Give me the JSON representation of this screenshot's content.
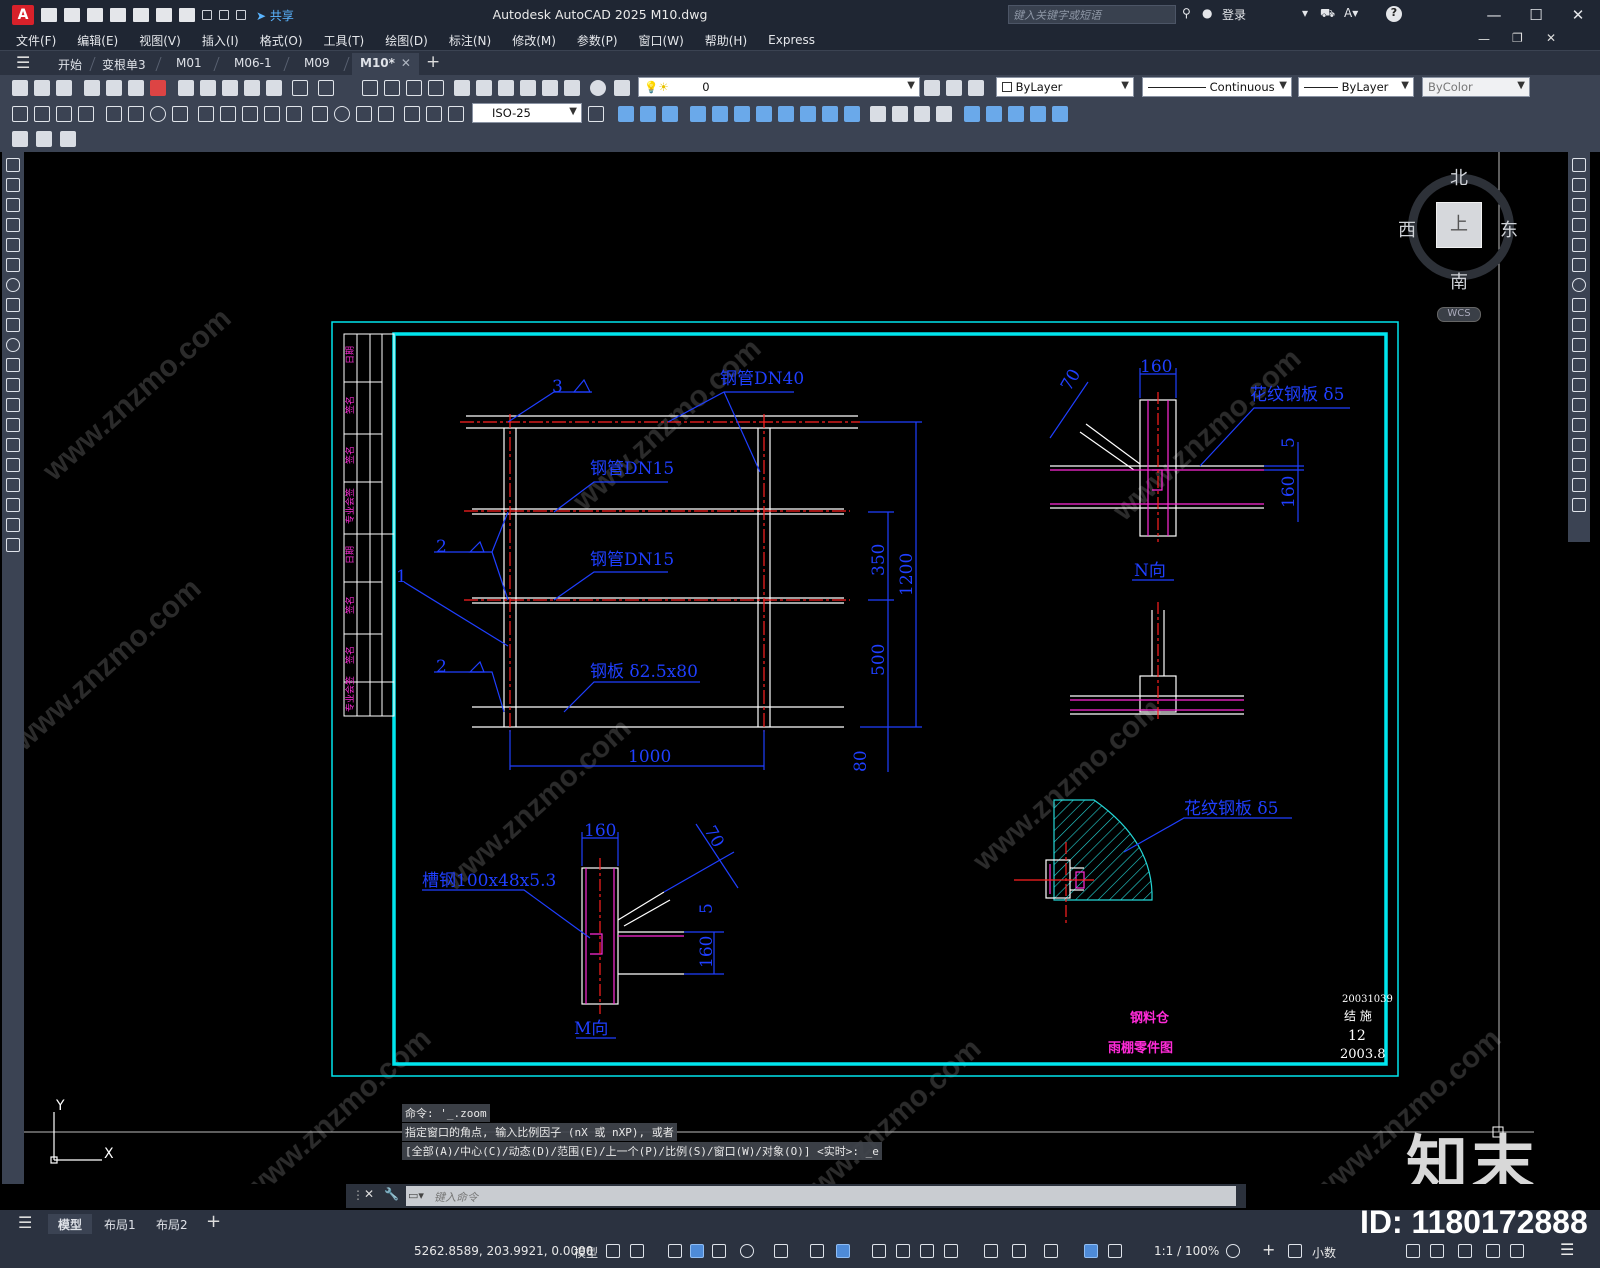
{
  "titlebar": {
    "logo": "A",
    "share_label": "共享",
    "title": "Autodesk AutoCAD 2025    M10.dwg",
    "search_placeholder": "键入关键字或短语",
    "login_label": "登录",
    "help_label": "?"
  },
  "menu": [
    "文件(F)",
    "编辑(E)",
    "视图(V)",
    "插入(I)",
    "格式(O)",
    "工具(T)",
    "绘图(D)",
    "标注(N)",
    "修改(M)",
    "参数(P)",
    "窗口(W)",
    "帮助(H)",
    "Express"
  ],
  "tabs": [
    {
      "label": "开始"
    },
    {
      "label": "变根单3"
    },
    {
      "label": "M01"
    },
    {
      "label": "M06-1"
    },
    {
      "label": "M09"
    },
    {
      "label": "M10*",
      "active": true
    }
  ],
  "toolbar": {
    "layer_value": "0",
    "color_value": "ByLayer",
    "linetype_value": "Continuous",
    "lineweight_value": "ByLayer",
    "plotstyle_value": "ByColor",
    "dimstyle_value": "ISO-25"
  },
  "viewcube": {
    "north": "北",
    "south": "南",
    "east": "东",
    "west": "西",
    "face": "上",
    "wcs": "WCS"
  },
  "drawing": {
    "labels": {
      "pipe_dn40": "钢管DN40",
      "pipe_dn15_a": "钢管DN15",
      "pipe_dn15_b": "钢管DN15",
      "plate": "钢板 δ2.5x80",
      "dim_1000": "1000",
      "dim_350": "350",
      "dim_1200": "1200",
      "dim_500": "500",
      "dim_80": "80",
      "weld_3": "3",
      "weld_2a": "2",
      "weld_2b": "2",
      "weld_1": "1",
      "n_dim_160": "160",
      "n_dim_70": "70",
      "n_checker": "花纹钢板 δ5",
      "n_dim_5": "5",
      "n_dim_160v": "160",
      "n_view": "N向",
      "m_dim_160": "160",
      "m_dim_70": "70",
      "m_channel": "槽钢100x48x5.3",
      "m_dim_5": "5",
      "m_dim_160v": "160",
      "m_view": "M向",
      "d_checker": "花纹钢板 δ5"
    },
    "titleblock": {
      "drawing_no": "20031039",
      "type": "结 施",
      "sheet": "12",
      "date": "2003.8",
      "project": "钢料仓",
      "name": "雨棚零件图"
    },
    "sidebar_cells": [
      "日期",
      "签名",
      "签名",
      "专业会签",
      "日期",
      "签名",
      "签名",
      "专业会签"
    ]
  },
  "command": {
    "line1": "命令: '_.zoom",
    "line2": "指定窗口的角点, 输入比例因子 (nX 或 nXP), 或者",
    "line3": "[全部(A)/中心(C)/动态(D)/范围(E)/上一个(P)/比例(S)/窗口(W)/对象(O)] <实时>: _e",
    "input_placeholder": "键入命令"
  },
  "ucs": {
    "x": "X",
    "y": "Y"
  },
  "layouts": [
    {
      "label": "模型",
      "active": true
    },
    {
      "label": "布局1"
    },
    {
      "label": "布局2"
    }
  ],
  "statusbar": {
    "coords": "5262.8589, 203.9921, 0.0000",
    "model_label": "模型",
    "scale_label": "1:1 / 100%",
    "units_label": "小数"
  },
  "watermark": {
    "logo": "知末",
    "id": "ID: 1180172888",
    "site": "www.znzmo.com"
  },
  "colors": {
    "frame": "#00e5ee",
    "dimension": "#1f3fff",
    "magenta": "#ff2bd8",
    "red": "#ff2020",
    "white": "#ffffff",
    "hatch": "#24d6d6"
  }
}
